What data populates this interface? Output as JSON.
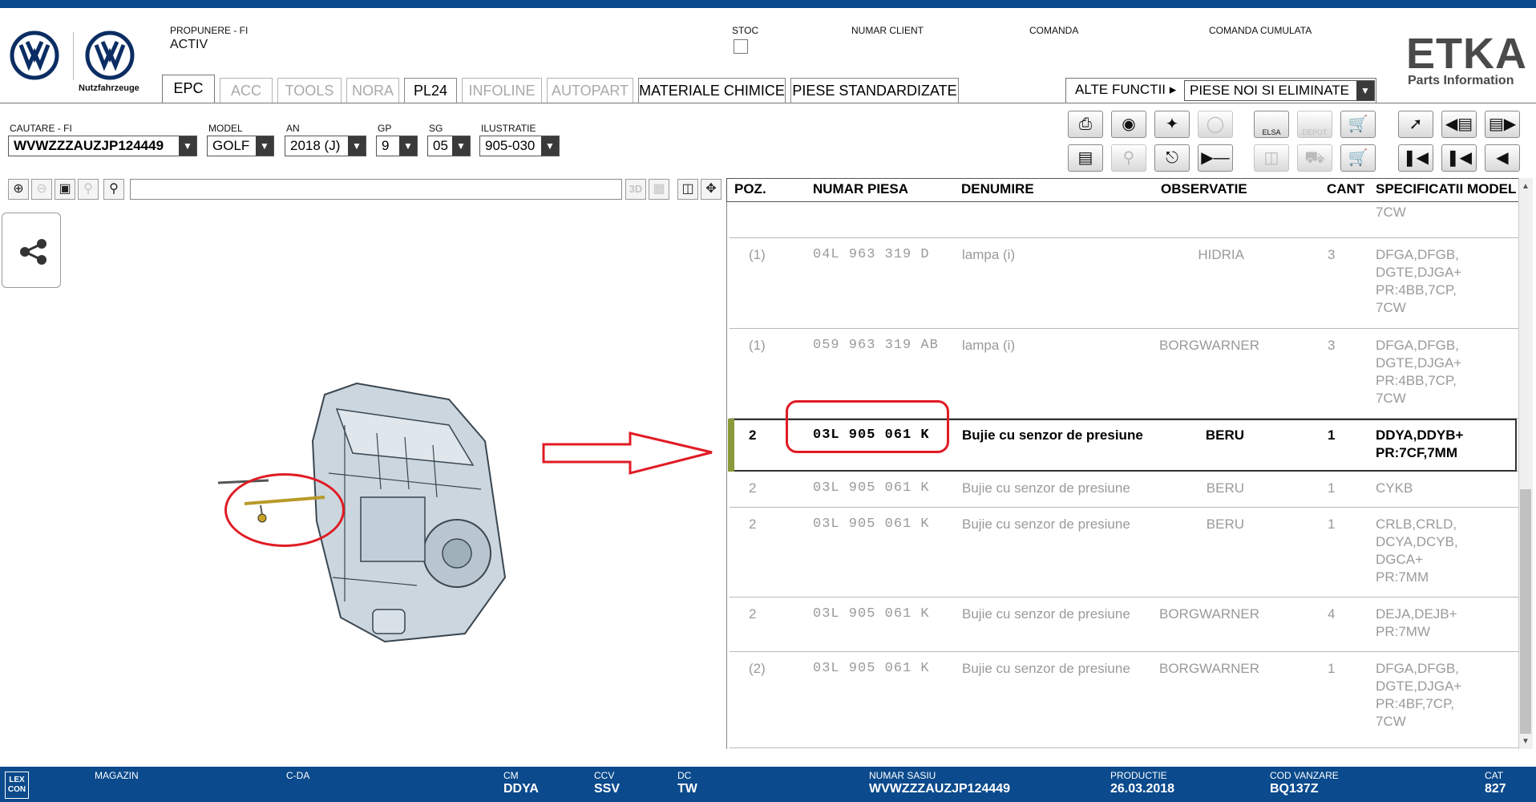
{
  "header": {
    "propunere_label": "PROPUNERE - FI",
    "propunere_value": "ACTIV",
    "stoc_label": "STOC",
    "numar_client_label": "NUMAR CLIENT",
    "comanda_label": "COMANDA",
    "comanda_cumulata_label": "COMANDA CUMULATA",
    "logo_caption": "Nutzfahrzeuge",
    "etka_title": "ETKA",
    "etka_subtitle": "Parts Information"
  },
  "tabs": [
    "EPC",
    "ACC",
    "TOOLS",
    "NORA",
    "PL24",
    "INFOLINE",
    "AUTOPART",
    "MATERIALE CHIMICE",
    "PIESE STANDARDIZATE"
  ],
  "alte_functii": {
    "label": "ALTE FUNCTII ▸",
    "selected": "PIESE NOI SI ELIMINATE"
  },
  "search": {
    "cautare_label": "CAUTARE - FI",
    "cautare_value": "WVWZZZAUZJP124449",
    "model_label": "MODEL",
    "model_value": "GOLF",
    "an_label": "AN",
    "an_value": "2018 (J)",
    "gp_label": "GP",
    "gp_value": "9",
    "sg_label": "SG",
    "sg_value": "05",
    "ilustratie_label": "ILUSTRATIE",
    "ilustratie_value": "905-030"
  },
  "viewer": {
    "btn_3d": "3D"
  },
  "table": {
    "headers": {
      "poz": "POZ.",
      "numar": "NUMAR PIESA",
      "denumire": "DENUMIRE",
      "observatie": "OBSERVATIE",
      "cant": "CANT",
      "spec": "SPECIFICATII MODEL"
    },
    "top_fragment": "7CW",
    "rows": [
      {
        "poz": "(1)",
        "numar": "04L 963 319 D",
        "denumire": "lampa (i)",
        "observatie": "HIDRIA",
        "cant": "3",
        "spec": "DFGA,DFGB,\nDGTE,DJGA+\nPR:4BB,7CP,\n7CW"
      },
      {
        "poz": "(1)",
        "numar": "059 963 319 AB",
        "denumire": "lampa (i)",
        "observatie": "BORGWARNER",
        "cant": "3",
        "spec": "DFGA,DFGB,\nDGTE,DJGA+\nPR:4BB,7CP,\n7CW"
      },
      {
        "poz": "2",
        "numar": "03L 905 061 K",
        "denumire": "Bujie cu senzor de presiune",
        "observatie": "BERU",
        "cant": "1",
        "spec": "DDYA,DDYB+\nPR:7CF,7MM"
      },
      {
        "poz": "2",
        "numar": "03L 905 061 K",
        "denumire": "Bujie cu senzor de presiune",
        "observatie": "BERU",
        "cant": "1",
        "spec": "CYKB"
      },
      {
        "poz": "2",
        "numar": "03L 905 061 K",
        "denumire": "Bujie cu senzor de presiune",
        "observatie": "BERU",
        "cant": "1",
        "spec": "CRLB,CRLD,\nDCYA,DCYB,\nDGCA+\nPR:7MM"
      },
      {
        "poz": "2",
        "numar": "03L 905 061 K",
        "denumire": "Bujie cu senzor de presiune",
        "observatie": "BORGWARNER",
        "cant": "4",
        "spec": "DEJA,DEJB+\nPR:7MW"
      },
      {
        "poz": "(2)",
        "numar": "03L 905 061 K",
        "denumire": "Bujie cu senzor de presiune",
        "observatie": "BORGWARNER",
        "cant": "1",
        "spec": "DFGA,DFGB,\nDGTE,DJGA+\nPR:4BF,7CP,\n7CW"
      }
    ]
  },
  "footer": {
    "logo": "LEX\nCON",
    "magazin_label": "MAGAZIN",
    "cda_label": "C-DA",
    "cm_label": "CM",
    "cm_value": "DDYA",
    "ccv_label": "CCV",
    "ccv_value": "SSV",
    "dc_label": "DC",
    "dc_value": "TW",
    "sasiu_label": "NUMAR SASIU",
    "sasiu_value": "WVWZZZAUZJP124449",
    "productie_label": "PRODUCTIE",
    "productie_value": "26.03.2018",
    "cod_label": "COD VANZARE",
    "cod_value": "BQ137Z",
    "cat_label": "CAT",
    "cat_value": "827"
  },
  "colors": {
    "brand": "#0b4a8c",
    "annotation": "#e01b24",
    "selected_marker": "#8a9a3a"
  },
  "icons": [
    "print-icon",
    "cd-icon",
    "handshake-icon",
    "search-cd-icon",
    "elsa-icon",
    "depot-icon",
    "cart-add-icon",
    "pin-icon",
    "doc-left-icon",
    "doc-right-icon",
    "list-icon",
    "key-icon",
    "car-network-icon",
    "play-minus-icon",
    "monitor-icon",
    "truck-icon",
    "cart-icon",
    "first-icon",
    "prev-icon",
    "back-icon",
    "share-icon",
    "zoom-in-icon",
    "zoom-out-icon",
    "zoom-fit-icon",
    "zoom-area-icon",
    "magnifier-icon"
  ]
}
